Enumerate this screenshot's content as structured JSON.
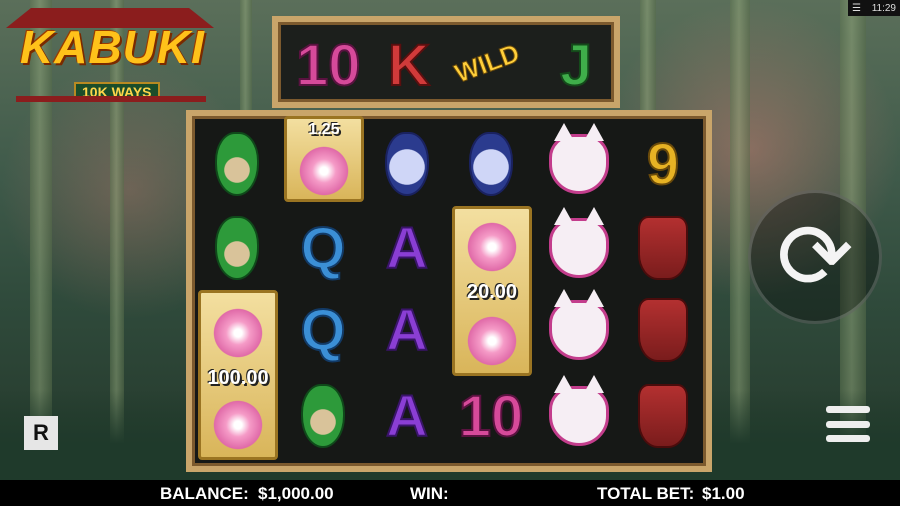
{
  "status": {
    "time": "11:29"
  },
  "logo": {
    "title": "KABUKI",
    "subtitle": "10K WAYS"
  },
  "top_reel": [
    "10",
    "K",
    "WILD",
    "J"
  ],
  "blossoms": [
    {
      "multiplier": "1.25"
    },
    {
      "multiplier": "20.00"
    },
    {
      "multiplier": "100.00"
    }
  ],
  "reels": {
    "r1": [
      "green-mask",
      "green-mask"
    ],
    "r2": [
      "Q",
      "Q",
      "green-mask"
    ],
    "r3": [
      "blue-mask",
      "A",
      "A",
      "A"
    ],
    "r4": [
      "blue-mask",
      "10"
    ],
    "r5": [
      "fox-mask",
      "fox-mask",
      "fox-mask",
      "fox-mask"
    ],
    "r6": [
      "9",
      "red-mask",
      "red-mask",
      "red-mask"
    ]
  },
  "bottom": {
    "balance_label": "BALANCE:",
    "balance_value": "$1,000.00",
    "win_label": "WIN:",
    "total_bet_label": "TOTAL BET:",
    "total_bet_value": "$1.00"
  },
  "icons": {
    "spin": "spin-icon",
    "menu": "menu-icon",
    "settings": "settings-icon"
  },
  "brand": {
    "logo_letter": "R"
  }
}
